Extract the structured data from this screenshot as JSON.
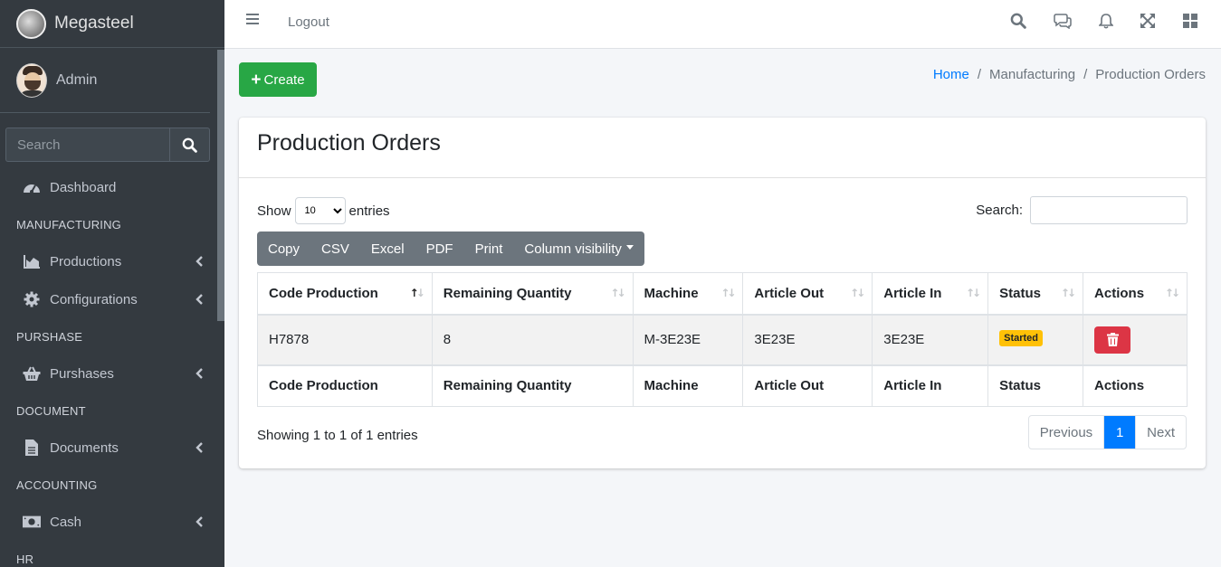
{
  "sidebar": {
    "brand": "Megasteel",
    "user": "Admin",
    "search_placeholder": "Search",
    "items": [
      {
        "type": "link",
        "label": "Dashboard",
        "icon": "tachometer-icon"
      },
      {
        "type": "header",
        "label": "MANUFACTURING"
      },
      {
        "type": "link",
        "label": "Productions",
        "icon": "area-chart-icon"
      },
      {
        "type": "link",
        "label": "Configurations",
        "icon": "gear-icon"
      },
      {
        "type": "header",
        "label": "PURSHASE"
      },
      {
        "type": "link",
        "label": "Purshases",
        "icon": "basket-icon"
      },
      {
        "type": "header",
        "label": "DOCUMENT"
      },
      {
        "type": "link",
        "label": "Documents",
        "icon": "file-icon"
      },
      {
        "type": "header",
        "label": "ACCOUNTING"
      },
      {
        "type": "link",
        "label": "Cash",
        "icon": "money-icon"
      },
      {
        "type": "header",
        "label": "HR"
      }
    ]
  },
  "topbar": {
    "logout": "Logout",
    "icons": [
      "search-icon",
      "comments-icon",
      "bell-icon",
      "expand-icon",
      "grid-icon"
    ]
  },
  "toolbar": {
    "create_label": "Create"
  },
  "breadcrumb": {
    "home": "Home",
    "section": "Manufacturing",
    "current": "Production Orders"
  },
  "card": {
    "title": "Production Orders"
  },
  "table_controls": {
    "show": "Show",
    "entries": "entries",
    "page_length": "10",
    "search_label": "Search:",
    "buttons": [
      "Copy",
      "CSV",
      "Excel",
      "PDF",
      "Print",
      "Column visibility"
    ]
  },
  "table": {
    "columns": [
      "Code Production",
      "Remaining Quantity",
      "Machine",
      "Article Out",
      "Article In",
      "Status",
      "Actions"
    ],
    "sorted_column": "Code Production",
    "rows": [
      {
        "code": "H7878",
        "remaining": "8",
        "machine": "M-3E23E",
        "article_out": "3E23E",
        "article_in": "3E23E",
        "status": "Started"
      }
    ]
  },
  "footer": {
    "info": "Showing 1 to 1 of 1 entries",
    "prev": "Previous",
    "page": "1",
    "next": "Next"
  },
  "colors": {
    "sidebar": "#343a40",
    "create": "#28a745",
    "status": "#ffc107",
    "delete": "#dc3545",
    "page_active": "#007bff"
  }
}
